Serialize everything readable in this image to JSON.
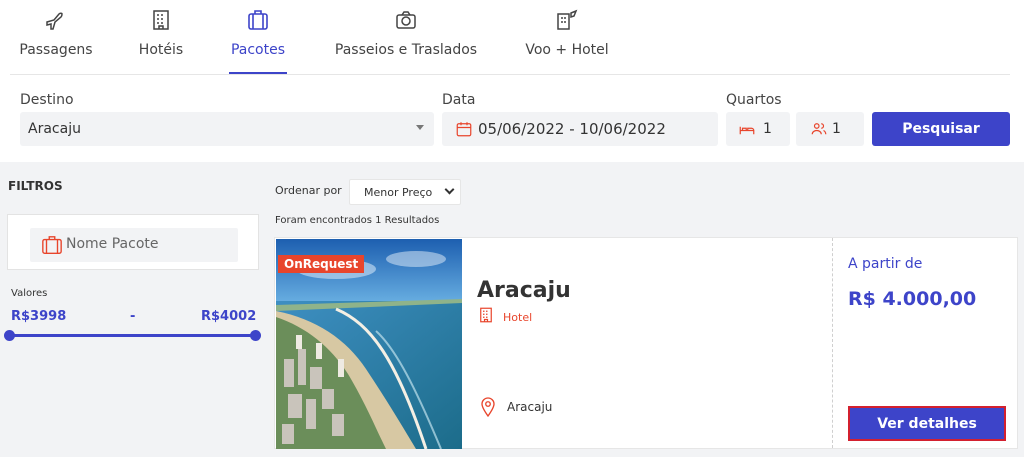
{
  "tabs": [
    {
      "label": "Passagens",
      "icon": "airplane-icon"
    },
    {
      "label": "Hotéis",
      "icon": "hotel-building-icon"
    },
    {
      "label": "Pacotes",
      "icon": "suitcase-icon",
      "active": true
    },
    {
      "label": "Passeios e Traslados",
      "icon": "camera-icon"
    },
    {
      "label": "Voo + Hotel",
      "icon": "flight-hotel-icon"
    }
  ],
  "search": {
    "destino_label": "Destino",
    "destino_value": "Aracaju",
    "data_label": "Data",
    "data_value": "05/06/2022 - 10/06/2022",
    "quartos_label": "Quartos",
    "rooms_value": "1",
    "guests_value": "1",
    "button_label": "Pesquisar"
  },
  "filters": {
    "title": "FILTROS",
    "package_name_label": "Nome Pacote",
    "valores_label": "Valores",
    "min_value": "R$3998",
    "range_separator": "-",
    "max_value": "R$4002"
  },
  "results": {
    "sort_label": "Ordenar por",
    "sort_value": "Menor Preço",
    "found_text": "Foram encontrados 1 Resultados",
    "items": [
      {
        "badge": "OnRequest",
        "title": "Aracaju",
        "type": "Hotel",
        "location": "Aracaju",
        "from_label": "A partir de",
        "price": "R$ 4.000,00",
        "button_label": "Ver detalhes"
      }
    ]
  },
  "colors": {
    "accent": "#3d44c9",
    "badge": "#e8452c",
    "background_gray": "#f2f3f5"
  }
}
